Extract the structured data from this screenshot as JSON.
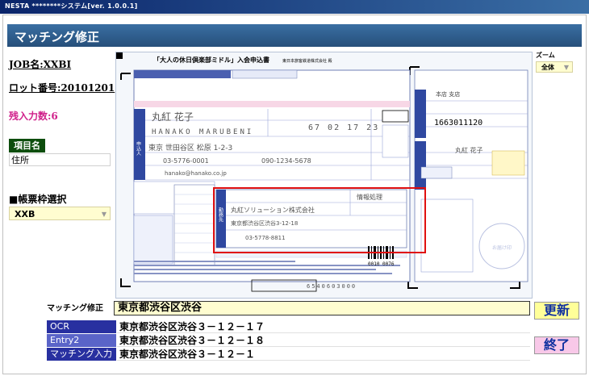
{
  "window": {
    "title": "NESTA ********システム[ver. 1.0.0.1]"
  },
  "header": {
    "title": "マッチング修正"
  },
  "info": {
    "job": "JOB名:XXBI",
    "lot": "ロット番号:20101201",
    "remaining": "残入力数:6"
  },
  "item": {
    "label": "項目名",
    "value": "住所"
  },
  "form_select": {
    "label": "■帳票枠選択",
    "value": "XXB"
  },
  "zoom": {
    "label": "ズーム",
    "value": "全体"
  },
  "document": {
    "title": "「大人の休日倶楽部ミドル」入会申込書",
    "company": "東日本旅客鉄道株式会社 殿",
    "name_kanji": "丸紅 花子",
    "name_kana": "HANAKO MARUBENI",
    "address": "東京 世田谷区 松原 1-2-3",
    "phone": "03-5776-0001",
    "mobile": "090-1234-5678",
    "email": "hanako@hanako.co.jp",
    "birth": "67 02 17 23",
    "work_name": "丸紅ソリューション株式会社",
    "work_dept": "情報処理",
    "work_address": "東京都渋谷区渋谷3-12-18",
    "work_phone": "03-5778-8811",
    "account": "1663011120",
    "serial": "0010 0076",
    "card_no": "6540603000",
    "applicant_section": "申込人",
    "work_section": "勤務先",
    "stamp_text": "お届け印",
    "branch": "本店 支店"
  },
  "matching": {
    "label": "マッチング修正",
    "value": "東京都渋谷区渋谷"
  },
  "results": [
    {
      "label": "OCR",
      "value": "東京都渋谷区渋谷３－１２－１７"
    },
    {
      "label": "Entry2",
      "value": "東京都渋谷区渋谷３－１２－１８"
    },
    {
      "label": "マッチング入力",
      "value": "東京都渋谷区渋谷３－１２－１"
    }
  ],
  "buttons": {
    "update": "更新",
    "end": "終了"
  }
}
